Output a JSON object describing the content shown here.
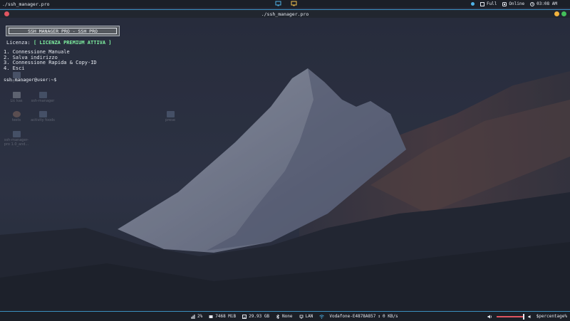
{
  "topbar": {
    "title": "./ssh_manager.pro",
    "layout_label": "Full",
    "network_status": "Online",
    "clock": "03:08 AM",
    "icons": [
      "monitor-icon",
      "display-icon",
      "app-status-icon",
      "layout-icon",
      "network-icon",
      "clock-icon"
    ]
  },
  "window": {
    "title": "./ssh_manager.pro"
  },
  "terminal": {
    "banner": "SSH MANAGER PRO - SSH PRO",
    "license_label": "Licenza:",
    "license_value": "[ LICENZA PREMIUM ATTIVA ]",
    "menu": [
      "1. Connessione Manuale",
      "2. Salva indirizzo",
      "3. Connessione Rapida & Copy-ID",
      "4. Esci"
    ],
    "prompt": "ssh-manager@user:~$"
  },
  "desktop": {
    "icons": [
      {
        "label": "Programmi",
        "icon": "folder-icon"
      },
      {
        "label": "Lic kas",
        "icon": "file-icon"
      },
      {
        "label": "ssh-manager",
        "icon": "folder-icon"
      },
      {
        "label": "tests",
        "icon": "disk-icon"
      },
      {
        "label": "activity foods",
        "icon": "folder-icon"
      },
      {
        "label": "prese",
        "icon": "folder-icon"
      },
      {
        "label": "ssh-manager-pro 1.0_and...",
        "icon": "folder-icon"
      }
    ]
  },
  "bottombar": {
    "cpu": "2%",
    "ram": "7468 MiB",
    "disk": "29.93 GB",
    "bluetooth": "None",
    "connection": "LAN",
    "wifi": "Vodafone-E4878A857",
    "speed": "0 KB/s",
    "volume_level": 0.95,
    "volume_label": "$percentage%",
    "colors": {
      "accent": "#3a8fbf",
      "volume": "#e05560"
    }
  }
}
